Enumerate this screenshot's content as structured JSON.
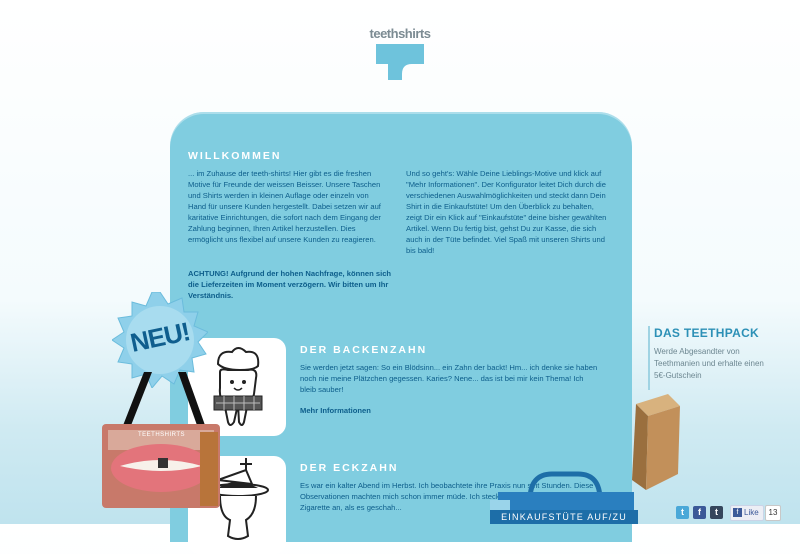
{
  "logo": {
    "text": "teethshirts"
  },
  "welcome": {
    "title": "WILLKOMMEN",
    "left_text": "... im Zuhause der teeth-shirts! Hier gibt es die freshen Motive für Freunde der weissen Beisser. Unsere Taschen und Shirts werden in kleinen Auflage oder einzeln von Hand für unsere Kunden hergestellt. Dabei setzen wir auf karitative Einrichtungen, die sofort nach dem Eingang der Zahlung beginnen, Ihren Artikel herzustellen. Dies ermöglicht uns flexibel auf unsere Kunden zu reagieren.",
    "notice": "ACHTUNG! Aufgrund der hohen Nachfrage, können sich die Lieferzeiten im Moment verzögern. Wir bitten um Ihr Verständnis.",
    "right_text": "Und so geht's: Wähle Deine Lieblings-Motive und klick auf \"Mehr Informationen\". Der Konfigurator leitet Dich durch die verschiedenen Auswahlmöglichkeiten und steckt dann Dein Shirt in die Einkaufstüte! Um den Überblick zu behalten, zeigt Dir ein Klick auf \"Einkaufstüte\" deine bisher gewählten Artikel. Wenn Du fertig bist, gehst Du zur Kasse, die sich auch in der Tüte befindet. Viel Spaß mit unseren Shirts und bis bald!"
  },
  "products": [
    {
      "title": "DER BACKENZAHN",
      "text": "Sie werden jetzt sagen: So ein Blödsinn... ein Zahn der backt! Hm... ich denke sie haben noch nie meine Plätzchen gegessen. Karies? Nene... das ist bei mir kein Thema! Ich bleib sauber!",
      "link": "Mehr Informationen"
    },
    {
      "title": "DER ECKZAHN",
      "text": "Es war ein kalter Abend im Herbst. Ich beobachtete ihre Praxis nun seit Stunden. Diese Observationen machten mich schon immer müde. Ich steckte ich mir gerade eine Zigarette an, als es geschah..."
    }
  ],
  "badge": {
    "text": "NEU!"
  },
  "bag_label": "TEETHSHIRTS",
  "teethpack": {
    "title": "DAS TEETHPACK",
    "text": "Werde Abgesandter von Teethmanien und erhalte einen 5€-Gutschein"
  },
  "cart": {
    "label": "EINKAUFSTÜTE AUF/ZU"
  },
  "social": {
    "twitter": "t",
    "facebook": "f",
    "tumblr": "t",
    "like_label": "Like",
    "like_count": "13"
  },
  "colors": {
    "panel": "#80cde0",
    "text": "#0d5e8b",
    "accent": "#1d6ea8",
    "side_title": "#2c90b6"
  }
}
